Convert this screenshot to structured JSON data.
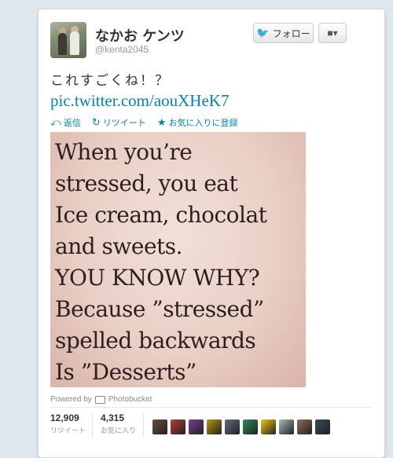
{
  "user": {
    "display_name": "なかお ケンツ",
    "screen_name": "@kenta2045"
  },
  "buttons": {
    "follow_label": "フォロー",
    "follow_icon": "twitter-bird-icon",
    "user_menu_icon": "user-dropdown-icon"
  },
  "tweet": {
    "text": "これすごくね！？",
    "link": "pic.twitter.com/aouXHeK7"
  },
  "actions": [
    {
      "icon": "reply-icon",
      "label": "返信"
    },
    {
      "icon": "retweet-icon",
      "label": "リツイート"
    },
    {
      "icon": "star-icon",
      "label": "お気に入りに登録"
    }
  ],
  "photo": {
    "lines": [
      "When you’re",
      "stressed, you eat",
      "Ice cream, chocolat",
      "and sweets.",
      "YOU KNOW WHY?",
      "Because ”stressed”",
      "spelled backwards",
      "Is ”Desserts”"
    ],
    "powered_by": "Powered by",
    "provider": "Photobucket"
  },
  "stats": {
    "retweets": {
      "count": "12,909",
      "label": "リツイート"
    },
    "favorites": {
      "count": "4,315",
      "label": "お気に入り"
    }
  },
  "faces": [
    {
      "color": "#6b4a3a"
    },
    {
      "color": "#c0392b"
    },
    {
      "color": "#7d3c98"
    },
    {
      "color": "#b7950b"
    },
    {
      "color": "#5d6d7e"
    },
    {
      "color": "#2e8b57"
    },
    {
      "color": "#f1c40f"
    },
    {
      "color": "#aab7b8"
    },
    {
      "color": "#8e6e53"
    },
    {
      "color": "#34495e"
    }
  ],
  "colors": {
    "link": "#0084b4",
    "background": "#dfe7ee"
  }
}
